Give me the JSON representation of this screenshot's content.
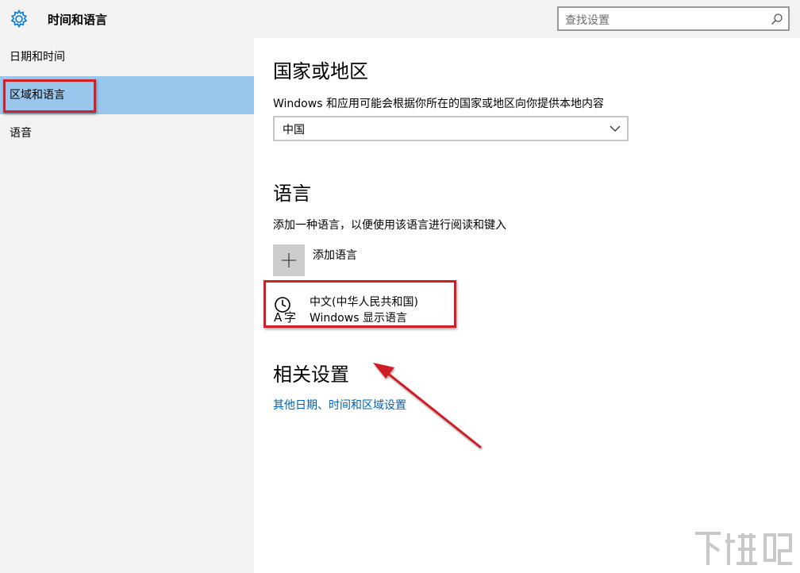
{
  "app": {
    "title": "时间和语言"
  },
  "search": {
    "placeholder": "查找设置"
  },
  "sidebar": {
    "items": [
      {
        "label": "日期和时间"
      },
      {
        "label": "区域和语言"
      },
      {
        "label": "语音"
      }
    ],
    "selected_index": 1
  },
  "region": {
    "heading": "国家或地区",
    "description": "Windows 和应用可能会根据你所在的国家或地区向你提供本地内容",
    "selected": "中国"
  },
  "language": {
    "heading": "语言",
    "description": "添加一种语言，以便使用该语言进行阅读和键入",
    "add_label": "添加语言",
    "items": [
      {
        "name": "中文(中华人民共和国)",
        "subtitle": "Windows 显示语言"
      }
    ]
  },
  "related": {
    "heading": "相关设置",
    "link": "其他日期、时间和区域设置"
  },
  "colors": {
    "accent": "#0063b1",
    "selected_nav": "#99c6ec",
    "annotation_red": "#d01f27"
  },
  "watermark": {
    "text": "下载吧"
  }
}
